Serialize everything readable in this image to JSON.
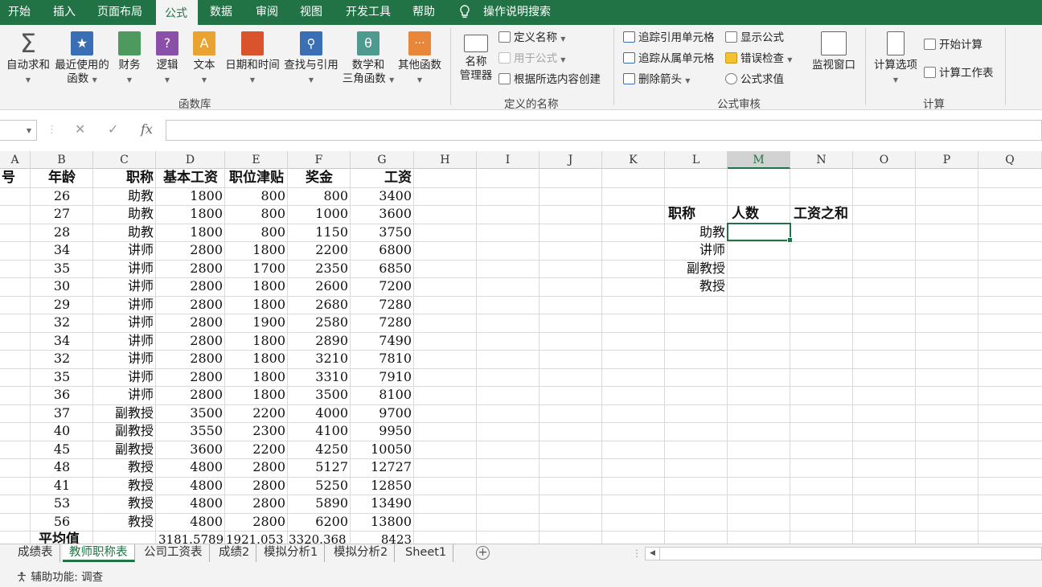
{
  "menu": {
    "items": [
      "开始",
      "插入",
      "页面布局",
      "公式",
      "数据",
      "审阅",
      "视图",
      "开发工具",
      "帮助"
    ],
    "active": "公式",
    "search_label": "操作说明搜索"
  },
  "ribbon": {
    "function_library": {
      "label": "函数库",
      "autosum": "自动求和",
      "recent_1": "最近使用的",
      "recent_2": "函数",
      "financial": "财务",
      "logical": "逻辑",
      "text": "文本",
      "datetime": "日期和时间",
      "lookup": "查找与引用",
      "math_1": "数学和",
      "math_2": "三角函数",
      "more": "其他函数"
    },
    "defined_names": {
      "label": "定义的名称",
      "manager_1": "名称",
      "manager_2": "管理器",
      "define": "定义名称",
      "use_in_formula": "用于公式",
      "create_from_selection": "根据所选内容创建"
    },
    "formula_auditing": {
      "label": "公式审核",
      "trace_precedents": "追踪引用单元格",
      "trace_dependents": "追踪从属单元格",
      "remove_arrows": "删除箭头",
      "show_formulas": "显示公式",
      "error_checking": "错误检查",
      "evaluate": "公式求值",
      "watch_window": "监视窗口"
    },
    "calculation": {
      "label": "计算",
      "options": "计算选项",
      "calc_now": "开始计算",
      "calc_sheet": "计算工作表"
    }
  },
  "formula_bar": {
    "cancel": "✕",
    "enter": "✓",
    "fx": "fx",
    "content": ""
  },
  "columns": [
    "A",
    "B",
    "C",
    "D",
    "E",
    "F",
    "G",
    "H",
    "I",
    "J",
    "K",
    "L",
    "M",
    "N",
    "O",
    "P",
    "Q"
  ],
  "selected_column": "M",
  "table": {
    "headers": [
      "号",
      "年龄",
      "职称",
      "基本工资",
      "职位津贴",
      "奖金",
      "工资"
    ],
    "rows": [
      [
        "26",
        "助教",
        "1800",
        "800",
        "800",
        "3400"
      ],
      [
        "27",
        "助教",
        "1800",
        "800",
        "1000",
        "3600"
      ],
      [
        "28",
        "助教",
        "1800",
        "800",
        "1150",
        "3750"
      ],
      [
        "34",
        "讲师",
        "2800",
        "1800",
        "2200",
        "6800"
      ],
      [
        "35",
        "讲师",
        "2800",
        "1700",
        "2350",
        "6850"
      ],
      [
        "30",
        "讲师",
        "2800",
        "1800",
        "2600",
        "7200"
      ],
      [
        "29",
        "讲师",
        "2800",
        "1800",
        "2680",
        "7280"
      ],
      [
        "32",
        "讲师",
        "2800",
        "1900",
        "2580",
        "7280"
      ],
      [
        "34",
        "讲师",
        "2800",
        "1800",
        "2890",
        "7490"
      ],
      [
        "32",
        "讲师",
        "2800",
        "1800",
        "3210",
        "7810"
      ],
      [
        "35",
        "讲师",
        "2800",
        "1800",
        "3310",
        "7910"
      ],
      [
        "36",
        "讲师",
        "2800",
        "1800",
        "3500",
        "8100"
      ],
      [
        "37",
        "副教授",
        "3500",
        "2200",
        "4000",
        "9700"
      ],
      [
        "40",
        "副教授",
        "3550",
        "2300",
        "4100",
        "9950"
      ],
      [
        "45",
        "副教授",
        "3600",
        "2200",
        "4250",
        "10050"
      ],
      [
        "48",
        "教授",
        "4800",
        "2800",
        "5127",
        "12727"
      ],
      [
        "41",
        "教授",
        "4800",
        "2800",
        "5250",
        "12850"
      ],
      [
        "53",
        "教授",
        "4800",
        "2800",
        "5890",
        "13490"
      ],
      [
        "56",
        "教授",
        "4800",
        "2800",
        "6200",
        "13800"
      ]
    ],
    "avg_label": "平均值",
    "avg_values": [
      "3181.5789",
      "1921.053",
      "3320.368",
      "8423"
    ]
  },
  "summary": {
    "headers": [
      "职称",
      "人数",
      "工资之和"
    ],
    "titles": [
      "助教",
      "讲师",
      "副教授",
      "教授"
    ]
  },
  "sheets": [
    "成绩表",
    "教师职称表",
    "公司工资表",
    "成绩2",
    "模拟分析1",
    "模拟分析2",
    "Sheet1"
  ],
  "active_sheet": "教师职称表",
  "status": "辅助功能: 调查",
  "colors": {
    "accent": "#217346",
    "ribbon_bg": "#f3f3f3"
  }
}
